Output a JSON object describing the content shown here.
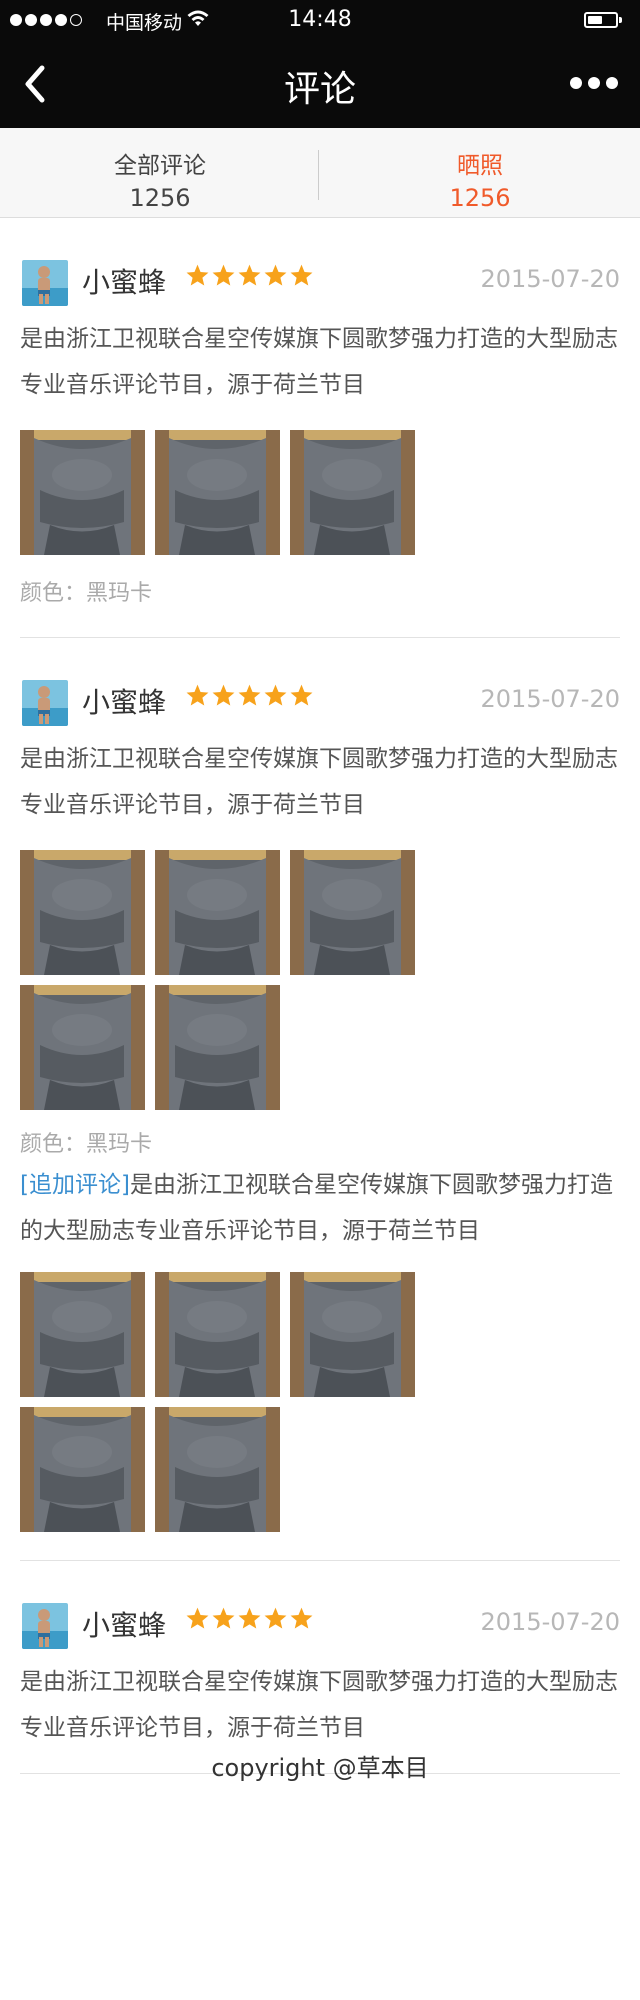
{
  "status_bar": {
    "carrier": "中国移动",
    "time": "14:48",
    "signal_bars_filled": 4,
    "signal_bars_total": 5,
    "battery_level": 0.55
  },
  "nav": {
    "title": "评论",
    "back_icon": "chevron-left-icon",
    "more_icon": "more-dots-icon"
  },
  "tabs": [
    {
      "label": "全部评论",
      "count": "1256",
      "active": false
    },
    {
      "label": "晒照",
      "count": "1256",
      "active": true
    }
  ],
  "colors": {
    "accent": "#f05a2a",
    "star": "#f7a21b",
    "link": "#3b8fd0",
    "nav_bg": "#0a0a0a"
  },
  "reviews": [
    {
      "user": "小蜜蜂",
      "rating": 5,
      "date": "2015-07-20",
      "text": "是由浙江卫视联合星空传媒旗下圆歌梦强力打造的大型励志专业音乐评论节目，源于荷兰节目",
      "photo_count": 3,
      "spec": "颜色：黑玛卡"
    },
    {
      "user": "小蜜蜂",
      "rating": 5,
      "date": "2015-07-20",
      "text": "是由浙江卫视联合星空传媒旗下圆歌梦强力打造的大型励志专业音乐评论节目，源于荷兰节目",
      "photo_count": 5,
      "spec": "颜色：黑玛卡",
      "follow_up": {
        "tag": "[追加评论]",
        "text": "是由浙江卫视联合星空传媒旗下圆歌梦强力打造的大型励志专业音乐评论节目，源于荷兰节目",
        "photo_count": 5
      }
    },
    {
      "user": "小蜜蜂",
      "rating": 5,
      "date": "2015-07-20",
      "text": "是由浙江卫视联合星空传媒旗下圆歌梦强力打造的大型励志专业音乐评论节目，源于荷兰节目",
      "photo_count": 0
    }
  ],
  "footer": {
    "copyright": "copyright @草本目"
  }
}
